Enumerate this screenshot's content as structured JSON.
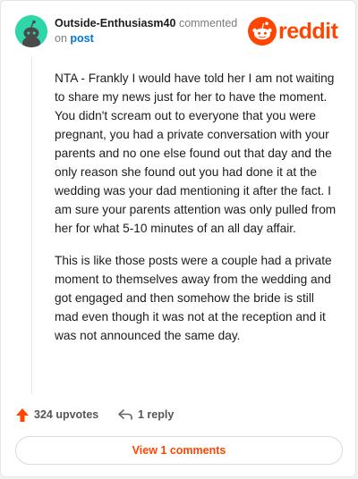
{
  "comment": {
    "username": "Outside-Enthusiasm40",
    "action_text": "commented",
    "on_text": "on",
    "post_link_text": "post",
    "paragraphs": [
      "NTA - Frankly I would have told her I am not waiting to share my news just for her to have the moment. You didn't scream out to everyone that you were pregnant, you had a private conversation with your parents and no one else found out that day and the only reason she found out you had done it at the wedding was your dad mentioning it after the fact. I am sure your parents attention was only pulled from her for what 5-10 minutes of an all day affair.",
      "This is like those posts were a couple had a private moment to themselves away from the wedding and got engaged and then somehow the bride is still mad even though it was not at the reception and it was not announced the same day."
    ]
  },
  "brand": {
    "name": "reddit",
    "color": "#ff4500"
  },
  "actions": {
    "upvotes_label": "324 upvotes",
    "reply_label": "1 reply"
  },
  "footer": {
    "view_comments_label": "View 1 comments"
  },
  "icons": {
    "avatar": "snoo-avatar-icon",
    "logo": "reddit-logo-icon",
    "upvote": "upvote-arrow-icon",
    "reply": "reply-arrow-icon"
  },
  "colors": {
    "accent": "#ff4500",
    "avatar_bg": "#2ed6a9",
    "link": "#0079d3"
  }
}
